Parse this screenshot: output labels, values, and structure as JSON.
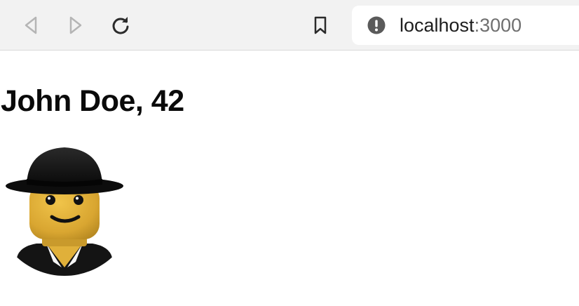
{
  "browser": {
    "url_host": "localhost",
    "url_port": ":3000",
    "icons": {
      "back": "back-arrow-icon",
      "forward": "forward-arrow-icon",
      "reload": "reload-icon",
      "bookmark": "bookmark-icon",
      "site_info": "info-icon"
    }
  },
  "profile": {
    "title": "John Doe, 42",
    "avatar": "lego-minifigure-avatar"
  },
  "colors": {
    "toolbar_bg": "#f2f2f2",
    "disabled_icon": "#b5b5b5",
    "active_icon": "#2b2b2b",
    "lego_yellow": "#e0b03a",
    "hat_black": "#111111"
  }
}
